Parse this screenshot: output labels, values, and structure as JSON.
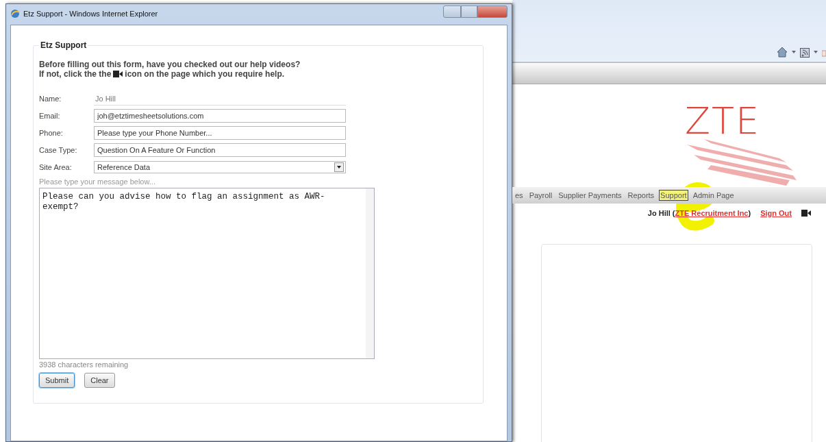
{
  "popup": {
    "title": "Etz Support - Windows Internet Explorer",
    "form": {
      "legend": "Etz Support",
      "intro_line_1": "Before filling out this form, have you checked out our help videos?",
      "intro_line_2_start": "If not, click the the",
      "intro_line_2_end": "icon on the page which you require help.",
      "fields": [
        {
          "kind": "static",
          "label": "Name:",
          "value": "Jo Hill"
        },
        {
          "kind": "text",
          "label": "Email:",
          "value": "joh@etztimesheetsolutions.com"
        },
        {
          "kind": "text",
          "label": "Phone:",
          "placeholder": "Please type your Phone Number..."
        },
        {
          "kind": "text",
          "label": "Case Type:",
          "value": "Question On A Feature Or Function"
        },
        {
          "kind": "select",
          "label": "Site Area:",
          "value": "Reference Data"
        }
      ],
      "message_hint": "Please type your message below...",
      "message": "Please can you advise how to flag an assignment as AWR-exempt?",
      "counter": "3938 characters remaining",
      "buttons": [
        {
          "label": "Submit",
          "focused": true
        },
        {
          "label": "Clear",
          "focused": false
        }
      ]
    }
  },
  "background_page": {
    "logo": "ZTE",
    "nav": [
      {
        "label": "es",
        "selected": false
      },
      {
        "label": "Payroll",
        "selected": false
      },
      {
        "label": "Supplier Payments",
        "selected": false
      },
      {
        "label": "Reports",
        "selected": false
      },
      {
        "label": "Support",
        "selected": true
      },
      {
        "label": "Admin Page",
        "selected": false
      }
    ],
    "user": "Jo Hill (",
    "company": "ZTE Recruitment Inc",
    "user_suffix": ")",
    "sign_out": "Sign Out"
  }
}
